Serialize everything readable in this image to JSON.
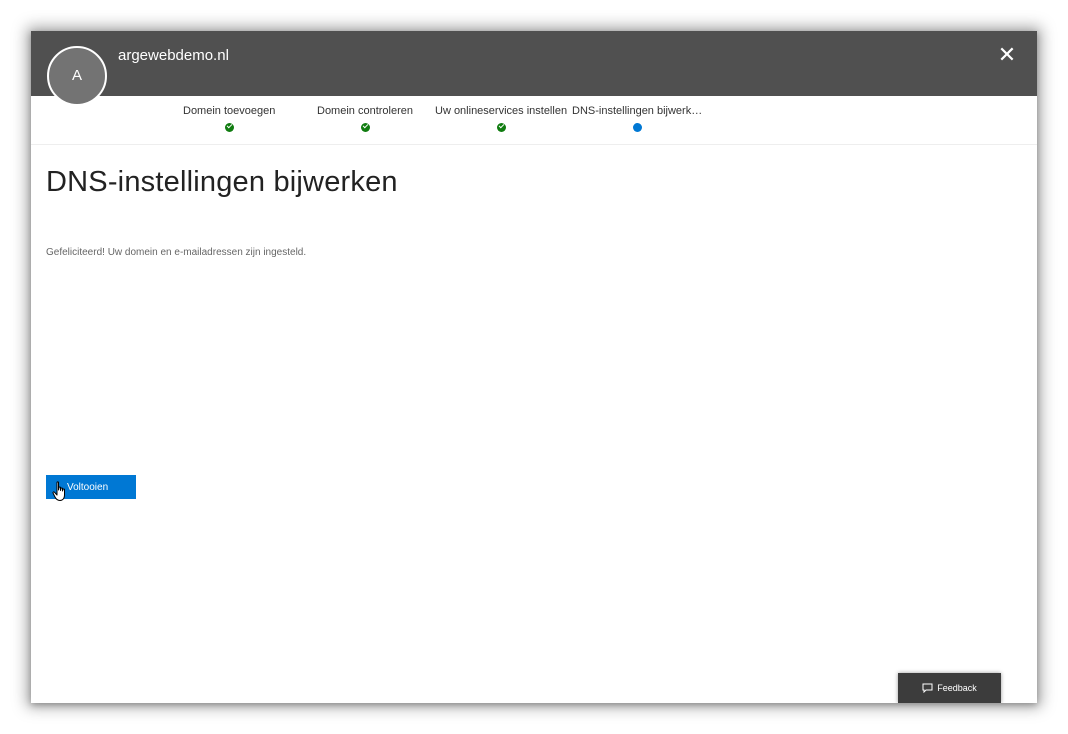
{
  "header": {
    "avatar_initial": "A",
    "domain": "argewebdemo.nl",
    "close_icon": "close-icon"
  },
  "steps": [
    {
      "label": "Domein toevoegen",
      "status": "done"
    },
    {
      "label": "Domein controleren",
      "status": "done"
    },
    {
      "label": "Uw onlineservices instellen",
      "status": "done"
    },
    {
      "label": "DNS-instellingen bijwerk…",
      "status": "current"
    }
  ],
  "main": {
    "title": "DNS-instellingen bijwerken",
    "message": "Gefeliciteerd! Uw domein en e-mailadressen zijn ingesteld.",
    "finish_label": "Voltooien"
  },
  "feedback": {
    "label": "Feedback",
    "icon": "comment-icon"
  },
  "colors": {
    "header_bg": "#505050",
    "accent": "#0078d4",
    "done": "#107c10"
  }
}
